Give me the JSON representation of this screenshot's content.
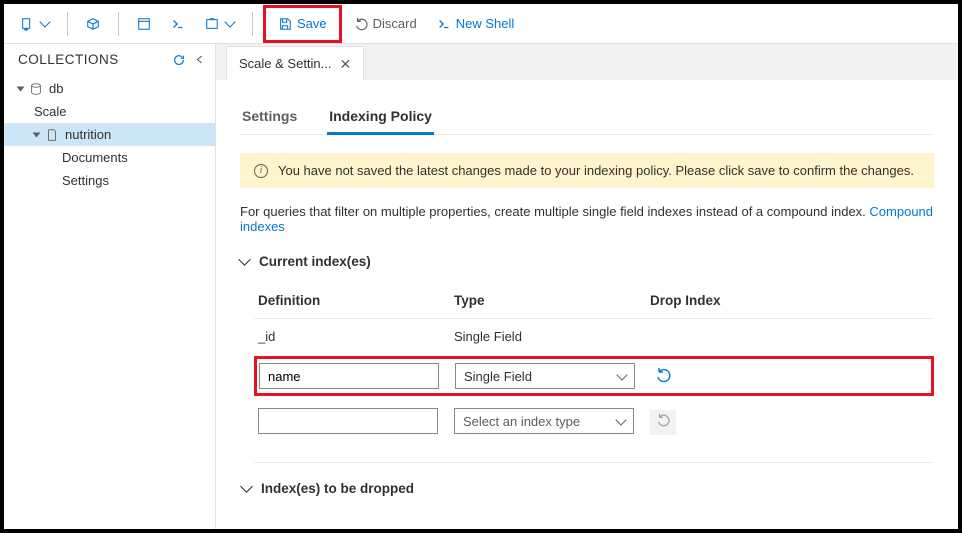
{
  "toolbar": {
    "save_label": "Save",
    "discard_label": "Discard",
    "new_shell_label": "New Shell"
  },
  "sidebar": {
    "title": "COLLECTIONS",
    "tree": {
      "db": "db",
      "scale": "Scale",
      "nutrition": "nutrition",
      "documents": "Documents",
      "settings": "Settings"
    }
  },
  "main": {
    "tab_label": "Scale & Settin...",
    "subtabs": {
      "settings": "Settings",
      "indexing": "Indexing Policy"
    },
    "warning": "You have not saved the latest changes made to your indexing policy. Please click save to confirm the changes.",
    "description_text": "For queries that filter on multiple properties, create multiple single field indexes instead of a compound index. ",
    "description_link": "Compound indexes",
    "sections": {
      "current": "Current index(es)",
      "dropped": "Index(es) to be dropped"
    },
    "table": {
      "headers": {
        "definition": "Definition",
        "type": "Type",
        "drop": "Drop Index"
      },
      "rows": [
        {
          "definition": "_id",
          "type": "Single Field",
          "editable": false
        },
        {
          "definition": "name",
          "type": "Single Field",
          "editable": true,
          "highlighted": true
        },
        {
          "definition": "",
          "type": "Select an index type",
          "editable": true,
          "placeholder": true
        }
      ]
    }
  }
}
